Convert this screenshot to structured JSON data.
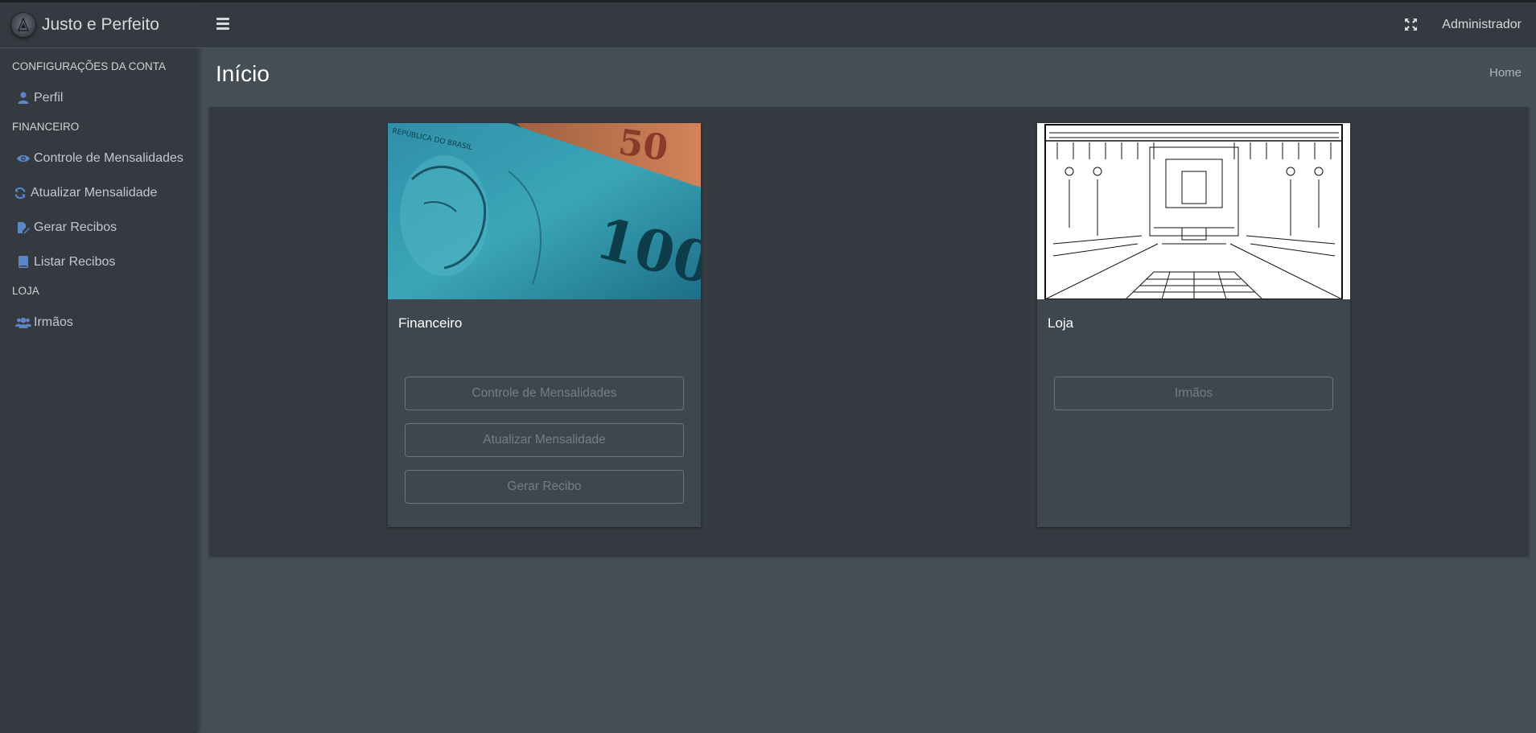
{
  "brand": {
    "name": "Justo e Perfeito"
  },
  "sidebar": {
    "sections": [
      {
        "header": "Configurações da Conta",
        "items": [
          {
            "label": "Perfil",
            "icon": "user-icon"
          }
        ]
      },
      {
        "header": "Financeiro",
        "items": [
          {
            "label": "Controle de Mensalidades",
            "icon": "eye-icon"
          },
          {
            "label": "Atualizar Mensalidade",
            "icon": "sync-icon"
          },
          {
            "label": "Gerar Recibos",
            "icon": "edit-file-icon"
          },
          {
            "label": "Listar Recibos",
            "icon": "book-icon"
          }
        ]
      },
      {
        "header": "Loja",
        "items": [
          {
            "label": "Irmãos",
            "icon": "users-icon"
          }
        ]
      }
    ]
  },
  "topbar": {
    "user": "Administrador"
  },
  "page": {
    "title": "Início",
    "breadcrumb": "Home"
  },
  "cards": [
    {
      "title": "Financeiro",
      "image": "brazilian-real-banknotes",
      "buttons": [
        "Controle de Mensalidades",
        "Atualizar Mensalidade",
        "Gerar Recibo"
      ]
    },
    {
      "title": "Loja",
      "image": "masonic-lodge-interior-drawing",
      "buttons": [
        "Irmãos"
      ]
    }
  ],
  "colors": {
    "sidebar": "#343a40",
    "content": "#454d55",
    "icon_accent": "#5b86c7"
  }
}
